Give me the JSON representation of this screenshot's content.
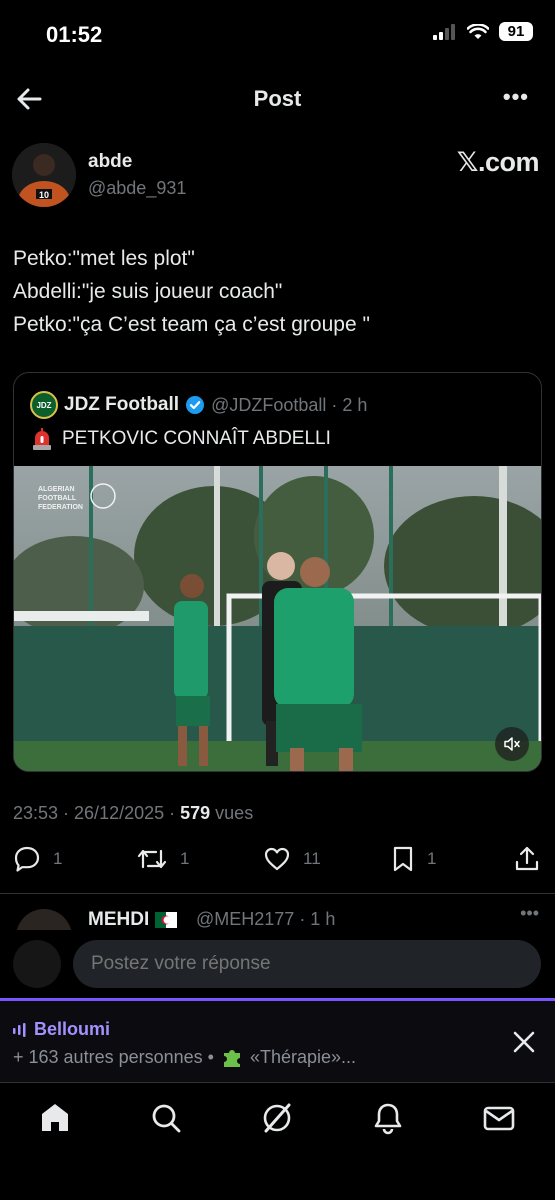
{
  "status": {
    "time": "01:52",
    "battery": "91"
  },
  "topbar": {
    "title": "Post",
    "more": "•••"
  },
  "author": {
    "name": "abde",
    "handle": "@abde_931",
    "source": "𝕏.com"
  },
  "post": {
    "lines": [
      "Petko:\"met les plot\"",
      "Abdelli:\"je suis joueur coach\"",
      "Petko:\"ça C’est team ça c’est groupe \""
    ],
    "timestamp": "23:53 · 26/12/2025 · ",
    "views_count": "579",
    "views_label": " vues"
  },
  "quote": {
    "logo_text": "JDZ",
    "name": "JDZ Football",
    "handle": "@JDZFootball · 2 h",
    "text": "PETKOVIC CONNAÎT ABDELLI",
    "media_watermark": [
      "ALGERIAN",
      "FOOTBALL",
      "FEDERATION"
    ]
  },
  "actions": {
    "replies": "1",
    "reposts": "1",
    "likes": "11",
    "bookmarks": "1"
  },
  "reply_peek": {
    "name": "MEHDI",
    "handle": "@MEH2177 · 1 h",
    "more": "•••"
  },
  "composer": {
    "placeholder": "Postez votre réponse"
  },
  "space": {
    "host": "Belloumi",
    "subtitle": "+ 163 autres personnes • ",
    "topic": "«Thérapie»..."
  },
  "colors": {
    "accent": "#1d9bf0",
    "space_purple": "#7856ff",
    "muted": "#71767b"
  },
  "icons": [
    "back-arrow-icon",
    "more-icon",
    "verified-icon",
    "siren-icon",
    "mute-icon",
    "reply-icon",
    "repost-icon",
    "like-icon",
    "bookmark-icon",
    "share-icon",
    "close-icon",
    "home-icon",
    "search-icon",
    "grok-icon",
    "notifications-icon",
    "messages-icon"
  ]
}
